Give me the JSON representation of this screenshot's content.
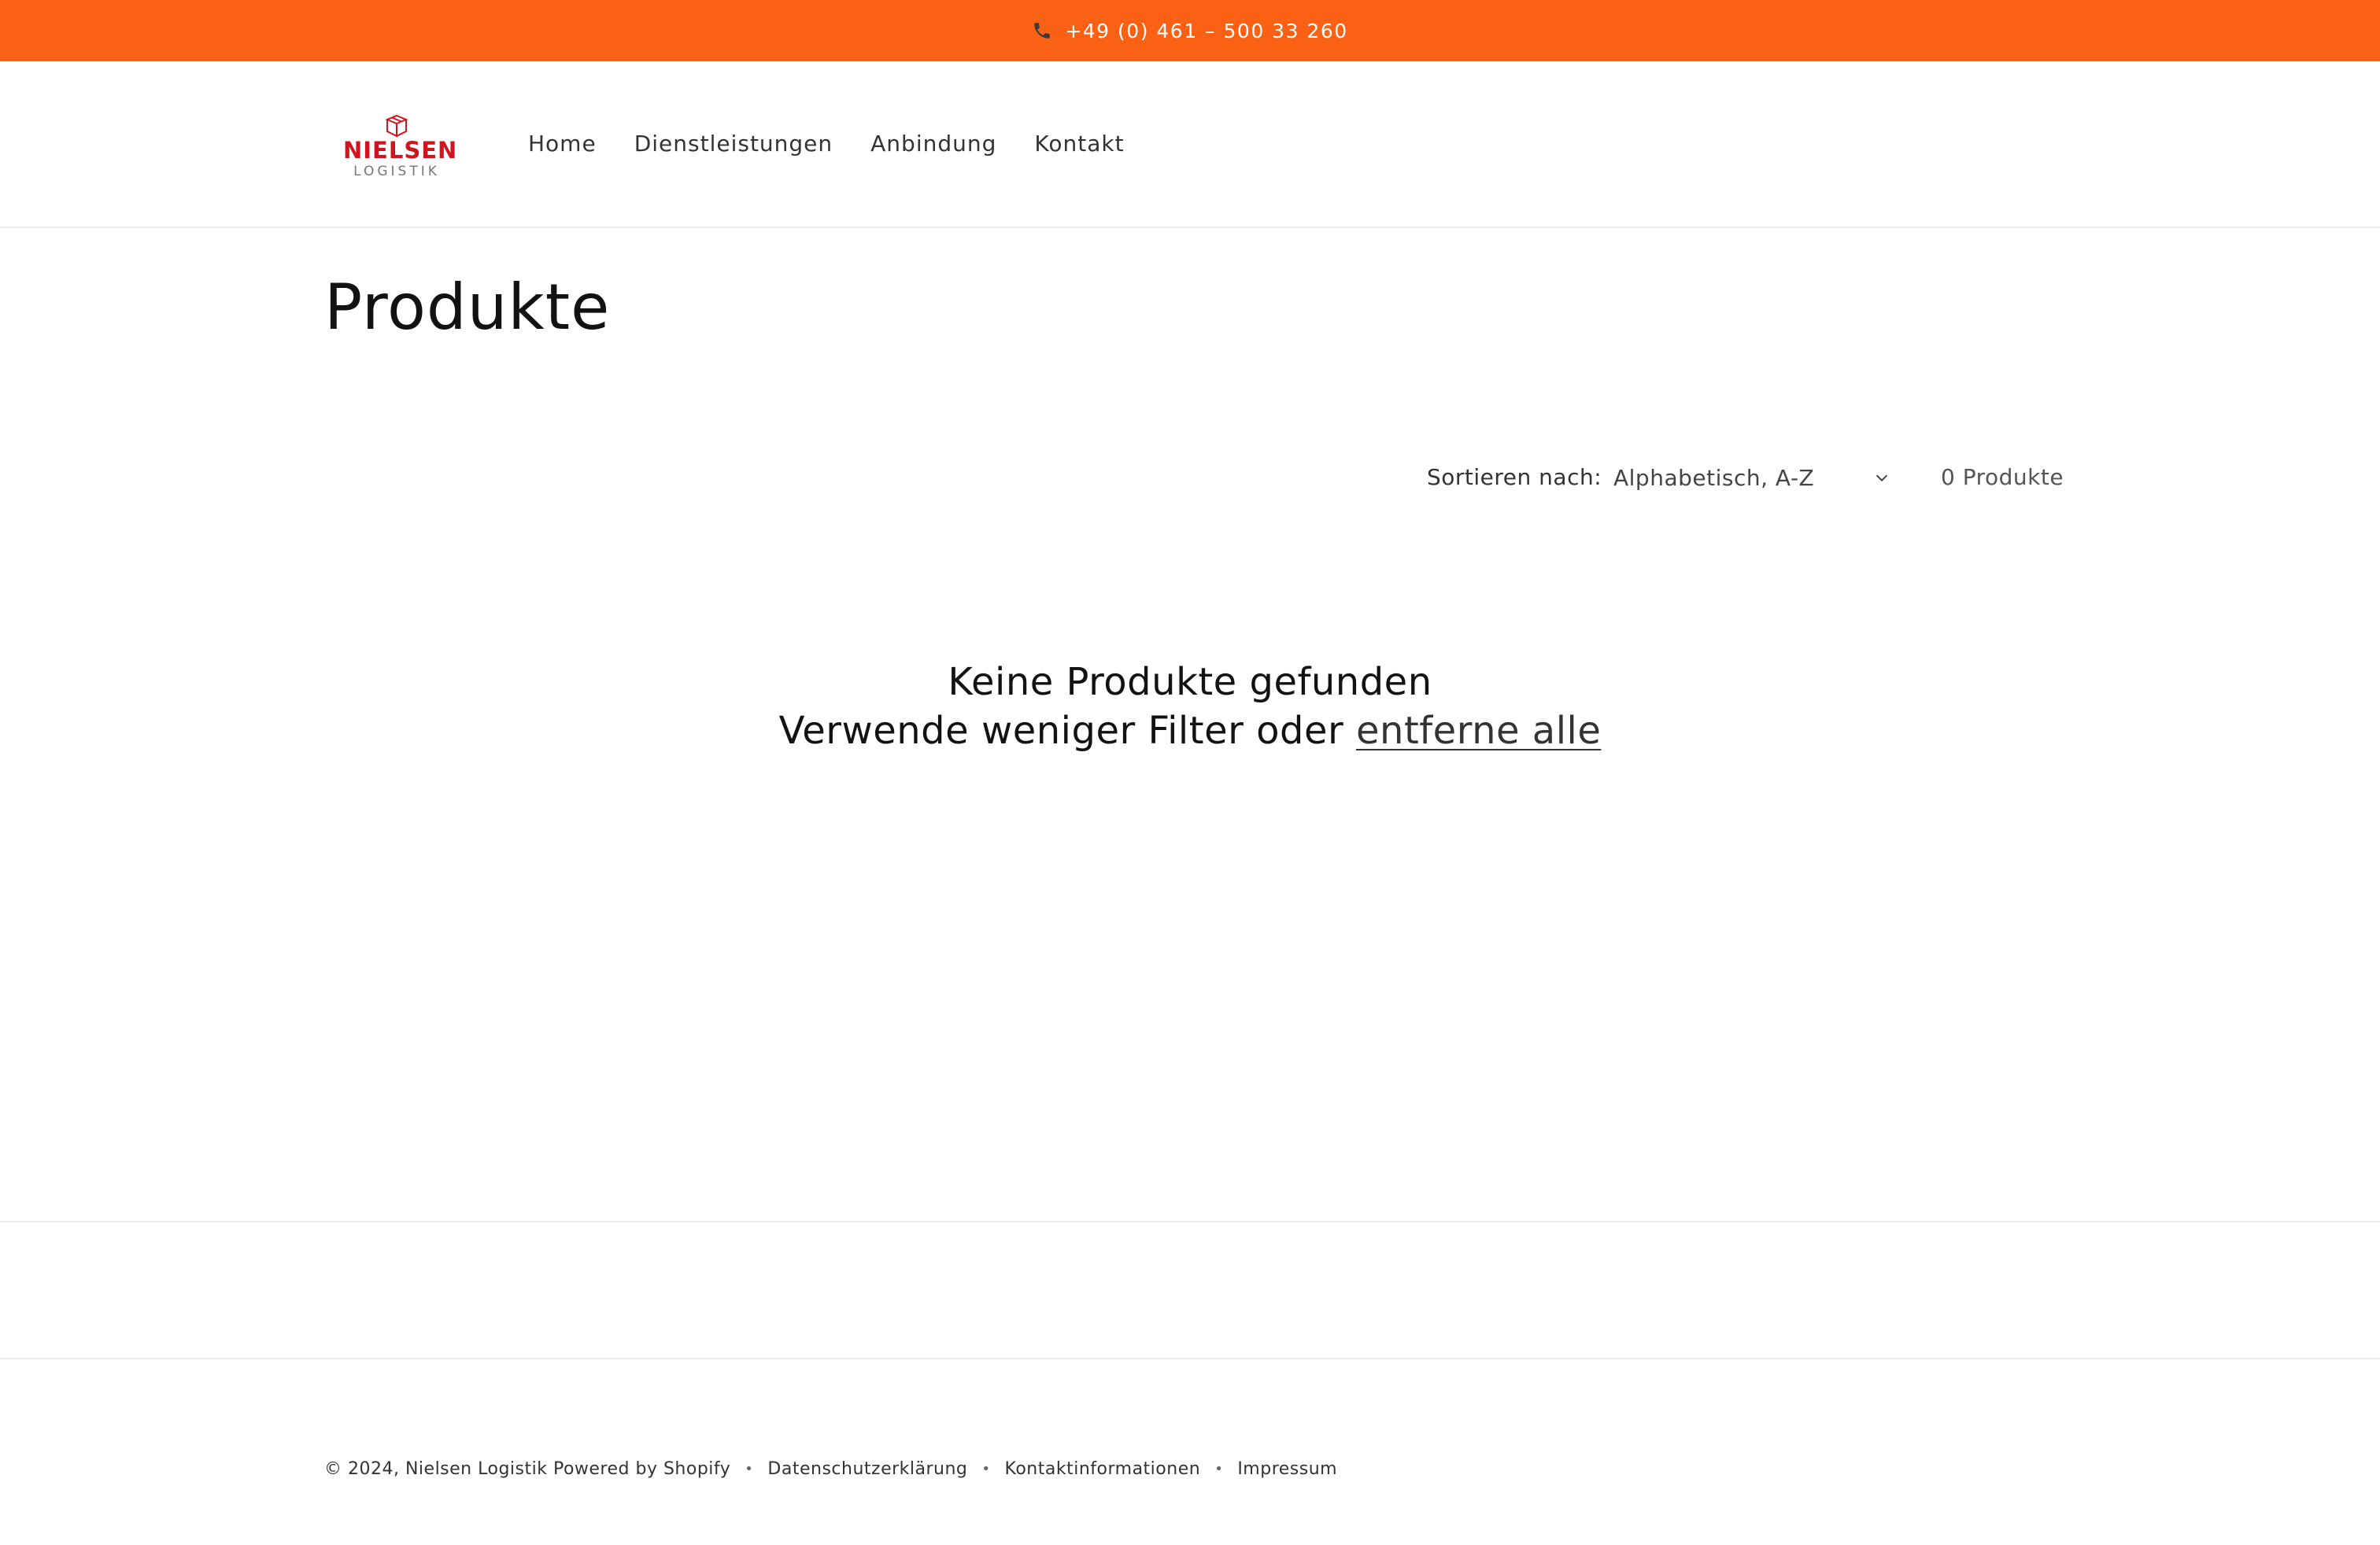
{
  "announcement": {
    "phone": "+49 (0) 461 – 500 33 260"
  },
  "header": {
    "logo": {
      "brand": "NIELSEN",
      "sub": "LOGISTIK"
    },
    "nav": [
      {
        "label": "Home"
      },
      {
        "label": "Dienstleistungen"
      },
      {
        "label": "Anbindung"
      },
      {
        "label": "Kontakt"
      }
    ]
  },
  "main": {
    "title": "Produkte",
    "sort_label": "Sortieren nach:",
    "sort_value": "Alphabetisch, A-Z",
    "count": "0 Produkte",
    "empty_title": "Keine Produkte gefunden",
    "empty_hint": "Verwende weniger Filter oder",
    "empty_link": "entferne alle"
  },
  "footer": {
    "copyright": "© 2024, Nielsen Logistik Powered by Shopify",
    "separator": "•",
    "links": [
      {
        "label": "Datenschutzerklärung"
      },
      {
        "label": "Kontaktinformationen"
      },
      {
        "label": "Impressum"
      }
    ]
  },
  "colors": {
    "accent": "#fa6114",
    "brand": "#d0131d"
  }
}
